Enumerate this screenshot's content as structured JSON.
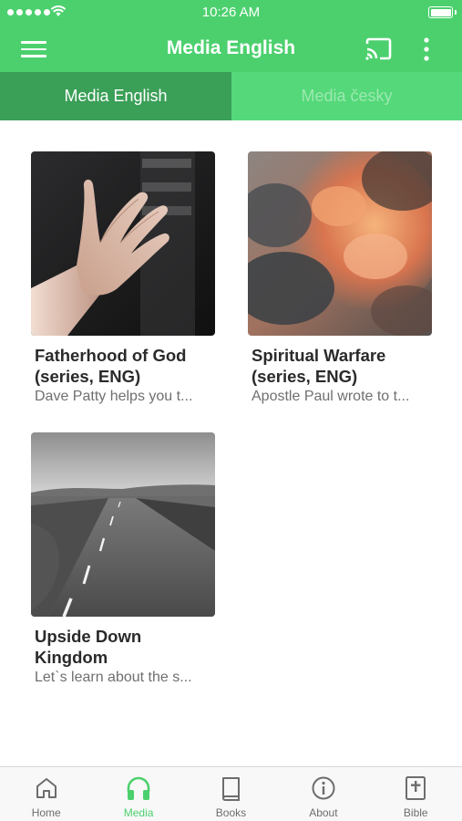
{
  "status": {
    "time": "10:26 AM"
  },
  "header": {
    "title": "Media English"
  },
  "tabs": [
    {
      "label": "Media English",
      "active": true
    },
    {
      "label": "Media česky",
      "active": false
    }
  ],
  "cards": [
    {
      "title_line1": "Fatherhood of God",
      "title_line2": "(series, ENG)",
      "description": "Dave Patty helps you t..."
    },
    {
      "title_line1": "Spiritual Warfare",
      "title_line2": "(series, ENG)",
      "description": "Apostle Paul wrote to t..."
    },
    {
      "title_line1": "Upside Down",
      "title_line2": "Kingdom",
      "description": "Let`s learn about the s..."
    }
  ],
  "bottom_nav": [
    {
      "label": "Home",
      "icon": "home-icon",
      "active": false
    },
    {
      "label": "Media",
      "icon": "headphones-icon",
      "active": true
    },
    {
      "label": "Books",
      "icon": "book-icon",
      "active": false
    },
    {
      "label": "About",
      "icon": "info-icon",
      "active": false
    },
    {
      "label": "Bible",
      "icon": "bible-icon",
      "active": false
    }
  ],
  "colors": {
    "primary": "#4cd06e",
    "tab_active": "#3a9f57",
    "tab_inactive": "#54d879",
    "nav_inactive": "#6d6d6d"
  }
}
